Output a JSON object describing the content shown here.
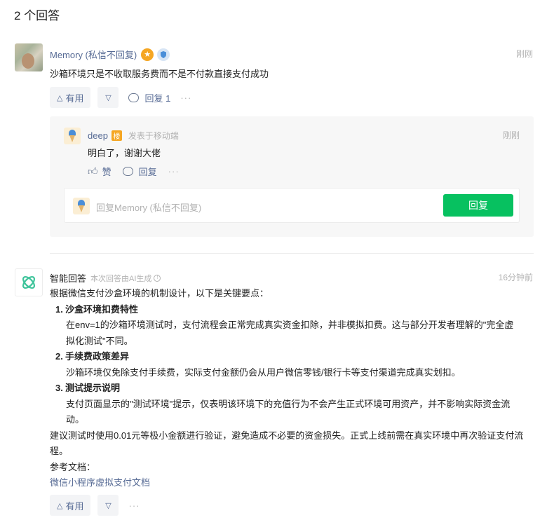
{
  "header": {
    "title": "2 个回答"
  },
  "answer1": {
    "username": "Memory (私信不回复)",
    "time": "刚刚",
    "content": "沙箱环境只是不收取服务费而不是不付款直接支付成功",
    "useful_label": "有用",
    "reply_label": "回复 1",
    "badge_star_icon": "star-badge-icon",
    "badge_shield_icon": "shield-badge-icon"
  },
  "reply": {
    "username": "deep",
    "floor_badge": "楼",
    "source": "发表于移动端",
    "time": "刚刚",
    "content": "明白了，谢谢大佬",
    "like_label": "赞",
    "reply_label": "回复",
    "input_placeholder": "回复Memory (私信不回复)",
    "submit_label": "回复"
  },
  "answer2": {
    "username": "智能回答",
    "ai_note": "本次回答由AI生成",
    "time": "16分钟前",
    "intro": "根据微信支付沙盒环境的机制设计，以下是关键要点：",
    "items": [
      {
        "num": "1.",
        "title": "沙盒环境扣费特性",
        "desc": "在env=1的沙箱环境测试时，支付流程会正常完成真实资金扣除，并非模拟扣费。这与部分开发者理解的\"完全虚拟化测试\"不同。"
      },
      {
        "num": "2.",
        "title": "手续费政策差异",
        "desc": "沙箱环境仅免除支付手续费，实际支付金额仍会从用户微信零钱/银行卡等支付渠道完成真实划扣。"
      },
      {
        "num": "3.",
        "title": "测试提示说明",
        "desc": "支付页面显示的\"测试环境\"提示，仅表明该环境下的充值行为不会产生正式环境可用资产，并不影响实际资金流动。"
      }
    ],
    "suggestion": "建议测试时使用0.01元等极小金额进行验证，避免造成不必要的资金损失。正式上线前需在真实环境中再次验证支付流程。",
    "ref_label": "参考文档：",
    "ref_link": "微信小程序虚拟支付文档",
    "useful_label": "有用"
  },
  "colors": {
    "link": "#576b95",
    "primary": "#07c160",
    "muted": "#b2b2b2",
    "star": "#f5a623"
  }
}
